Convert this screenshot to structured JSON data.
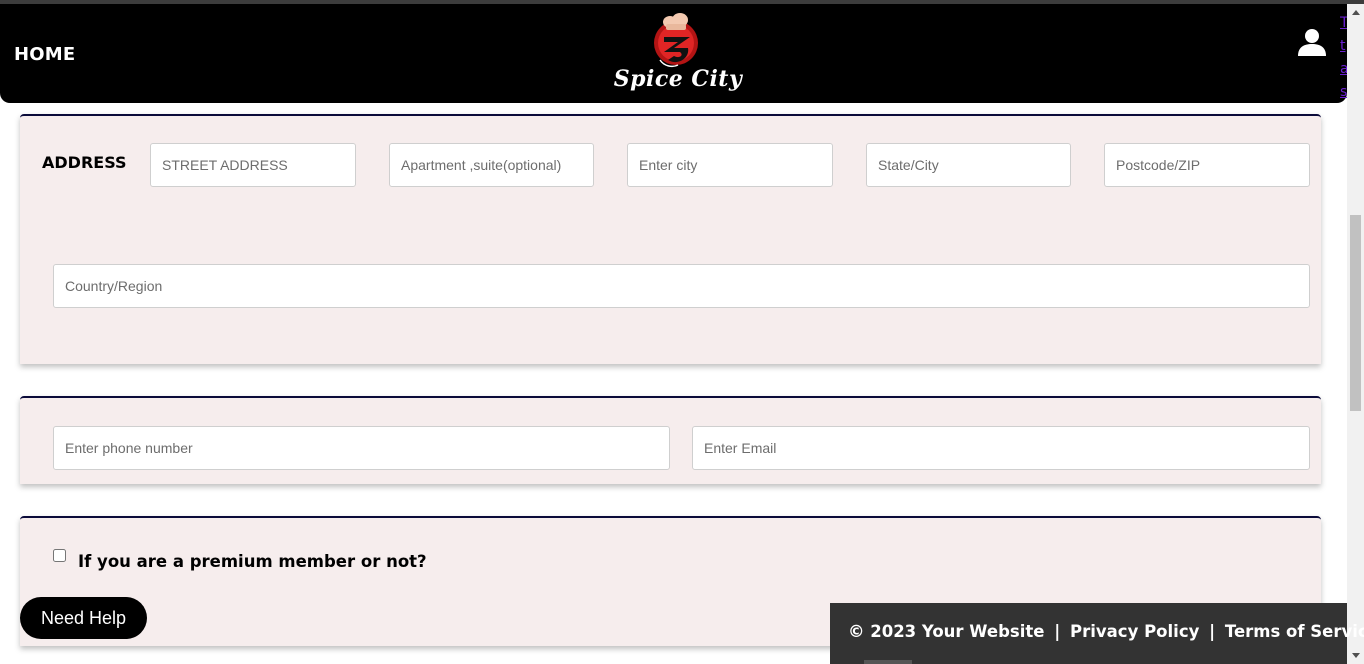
{
  "nav": {
    "home_label": "HOME",
    "logo_text": "Spice City",
    "user_icon": "user-icon",
    "edge_links": [
      "T",
      "t",
      "a",
      "s"
    ]
  },
  "address": {
    "label": "ADDRESS",
    "street_placeholder": "STREET ADDRESS",
    "apartment_placeholder": "Apartment ,suite(optional)",
    "city_placeholder": "Enter city",
    "state_placeholder": "State/City",
    "postcode_placeholder": "Postcode/ZIP",
    "country_placeholder": "Country/Region"
  },
  "contact": {
    "phone_placeholder": "Enter phone number",
    "email_placeholder": "Enter Email"
  },
  "membership": {
    "checkbox_label": "If you are a premium member or not?",
    "checked": false
  },
  "help_button_label": "Need Help",
  "footer": {
    "copyright": "© 2023 Your Website",
    "separator": "|",
    "privacy": "Privacy Policy",
    "terms": "Terms of Service"
  },
  "colors": {
    "navbar": "#000000",
    "card_background": "#f6eded",
    "card_border_top": "#0b0b3a",
    "footer": "#333333",
    "logo_red": "#d01a1a"
  }
}
